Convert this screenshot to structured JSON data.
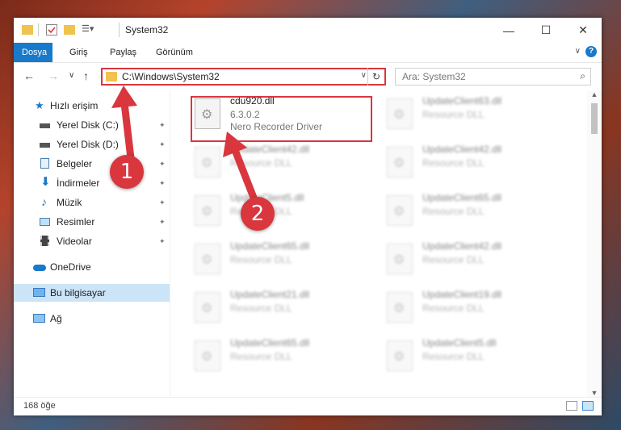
{
  "window": {
    "title": "System32",
    "controls": {
      "minimize": "—",
      "maximize": "☐",
      "close": "✕"
    }
  },
  "ribbon": {
    "tabs": [
      "Dosya",
      "Giriş",
      "Paylaş",
      "Görünüm"
    ],
    "help": "?",
    "collapse": "∨"
  },
  "nav": {
    "back": "←",
    "forward": "→",
    "recent": "∨",
    "up": "↑",
    "address": "C:\\Windows\\System32",
    "address_dropdown": "∨",
    "refresh": "↻",
    "search_placeholder": "Ara: System32",
    "search_icon": "⌕"
  },
  "sidebar": {
    "quick_access": "Hızlı erişim",
    "pinned": [
      {
        "label": "Yerel Disk (C:)",
        "icon": "drive-icon"
      },
      {
        "label": "Yerel Disk (D:)",
        "icon": "drive-icon"
      },
      {
        "label": "Belgeler",
        "icon": "documents-icon"
      },
      {
        "label": "İndirmeler",
        "icon": "downloads-icon"
      },
      {
        "label": "Müzik",
        "icon": "music-icon"
      },
      {
        "label": "Resimler",
        "icon": "pictures-icon"
      },
      {
        "label": "Videolar",
        "icon": "videos-icon"
      }
    ],
    "pin_glyph": "📌",
    "onedrive": "OneDrive",
    "this_pc": "Bu bilgisayar",
    "network": "Ağ"
  },
  "files": [
    {
      "name": "cdu920.dll",
      "version": "6.3.0.2",
      "description": "Nero Recorder Driver"
    },
    {
      "name": "UpdateClient63.dll",
      "description": "Resource DLL"
    },
    {
      "name": "UpdateClient42.dll",
      "description": "Resource DLL"
    },
    {
      "name": "UpdateClient42.dll",
      "description": "Resource DLL"
    },
    {
      "name": "UpdateClient5.dll",
      "description": "Resource DLL"
    },
    {
      "name": "UpdateClient65.dll",
      "description": "Resource DLL"
    },
    {
      "name": "UpdateClient65.dll",
      "description": "Resource DLL"
    },
    {
      "name": "UpdateClient42.dll",
      "description": "Resource DLL"
    },
    {
      "name": "UpdateClient21.dll",
      "description": "Resource DLL"
    },
    {
      "name": "UpdateClient19.dll",
      "description": "Resource DLL"
    },
    {
      "name": "UpdateClient65.dll",
      "description": "Resource DLL"
    },
    {
      "name": "UpdateClient5.dll",
      "description": "Resource DLL"
    }
  ],
  "annotations": {
    "step1": "1",
    "step2": "2"
  },
  "status": {
    "item_count": "168 öğe"
  },
  "colors": {
    "accent": "#1979ca",
    "highlight": "#d9363e",
    "selected": "#cce4f7"
  }
}
